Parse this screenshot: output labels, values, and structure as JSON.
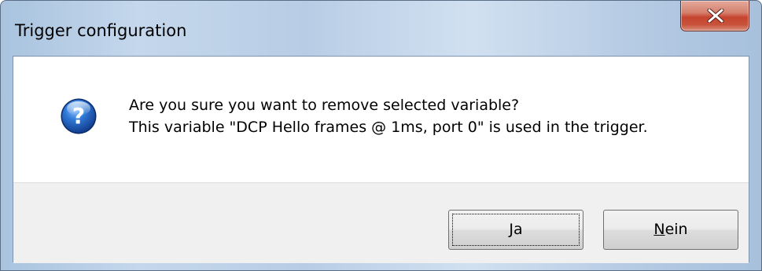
{
  "window": {
    "title": "Trigger configuration",
    "close_icon": "close-x-icon"
  },
  "dialog": {
    "icon": "question-icon",
    "message_line1": "Are you sure you want to remove selected variable?",
    "message_line2": "This variable \"DCP Hello frames @ 1ms, port 0\" is used in the trigger."
  },
  "buttons": {
    "yes": {
      "mnemonic": "J",
      "rest": "a"
    },
    "no": {
      "mnemonic": "N",
      "rest": "ein"
    }
  },
  "colors": {
    "close_button": "#c6452f",
    "question_icon": "#1f5fb8"
  }
}
